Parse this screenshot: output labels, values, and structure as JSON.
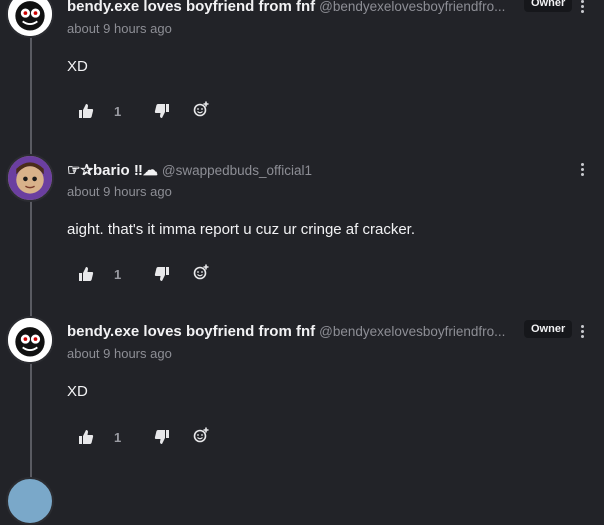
{
  "comments": [
    {
      "username": "bendy.exe loves boyfriend from fnf",
      "handle": "@bendyexelovesboyfriendfro...",
      "time": "about 9 hours ago",
      "badge": "Owner",
      "text": "XD",
      "likes": "1"
    },
    {
      "username": "☞✰bario ‼︎☁︎",
      "handle": "@swappedbuds_official1",
      "time": "about 9 hours ago",
      "badge": "",
      "text": "aight. that's it imma report u cuz ur cringe af cracker.",
      "likes": "1"
    },
    {
      "username": "bendy.exe loves boyfriend from fnf",
      "handle": "@bendyexelovesboyfriendfro...",
      "time": "about 9 hours ago",
      "badge": "Owner",
      "text": "XD",
      "likes": "1"
    }
  ],
  "icons": {
    "like": "thumbs-up-icon",
    "dislike": "thumbs-down-icon",
    "react": "add-reaction-icon",
    "more": "more-options-icon"
  },
  "colors": {
    "background": "#222328",
    "muted": "#8d8e95",
    "badge_bg": "#16171b"
  }
}
